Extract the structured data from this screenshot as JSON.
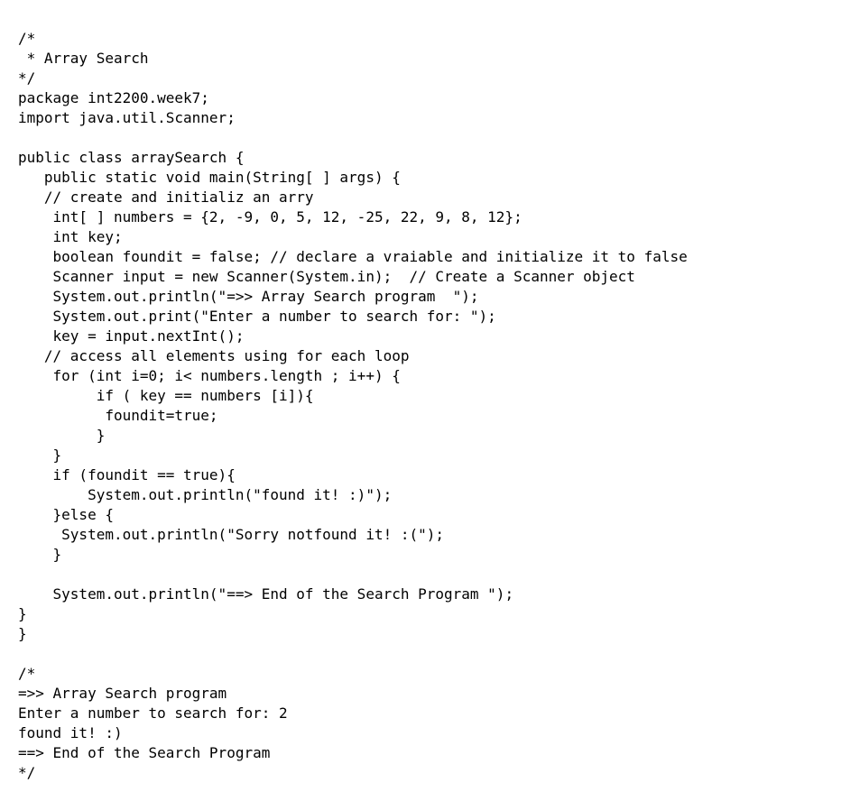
{
  "code": {
    "lines": [
      "/*",
      " * Array Search",
      "*/",
      "package int2200.week7;",
      "import java.util.Scanner;",
      "",
      "public class arraySearch {",
      "   public static void main(String[ ] args) {",
      "   // create and initializ an arry",
      "    int[ ] numbers = {2, -9, 0, 5, 12, -25, 22, 9, 8, 12};",
      "    int key;",
      "    boolean foundit = false; // declare a vraiable and initialize it to false",
      "    Scanner input = new Scanner(System.in);  // Create a Scanner object",
      "    System.out.println(\"=>> Array Search program  \");",
      "    System.out.print(\"Enter a number to search for: \");",
      "    key = input.nextInt();",
      "   // access all elements using for each loop",
      "    for (int i=0; i< numbers.length ; i++) {",
      "         if ( key == numbers [i]){",
      "          foundit=true;",
      "         }",
      "    }",
      "    if (foundit == true){",
      "        System.out.println(\"found it! :)\");",
      "    }else {",
      "     System.out.println(\"Sorry notfound it! :(\");",
      "    }",
      "",
      "    System.out.println(\"==> End of the Search Program \");",
      "}",
      "}",
      "",
      "/*",
      "=>> Array Search program  ",
      "Enter a number to search for: 2",
      "found it! :)",
      "==> End of the Search Program ",
      "*/"
    ]
  }
}
